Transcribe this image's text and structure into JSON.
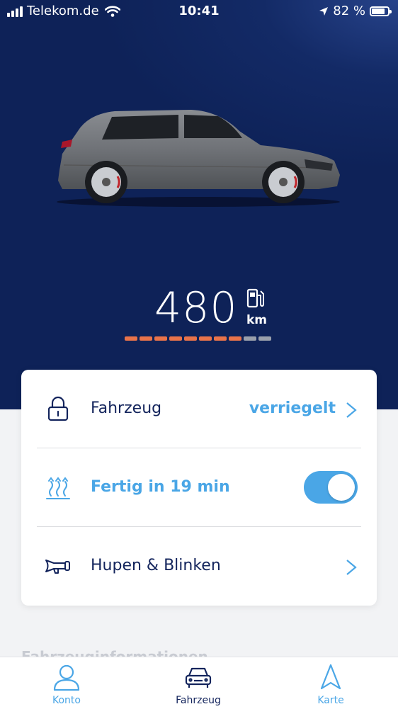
{
  "status_bar": {
    "carrier": "Telekom.de",
    "time": "10:41",
    "battery_percent": "82 %",
    "battery_level": 0.82
  },
  "vehicle": {
    "range_value": "480",
    "range_unit": "km",
    "range_segments_total": 10,
    "range_segments_filled": 8,
    "colors": {
      "filled": "#e8734a",
      "empty": "#9aa0ac"
    }
  },
  "controls": {
    "lock": {
      "label": "Fahrzeug",
      "value": "verriegelt",
      "icon": "lock-icon"
    },
    "climate": {
      "label": "Fertig in 19 min",
      "icon": "heat-waves-icon",
      "toggle_on": true
    },
    "horn": {
      "label": "Hupen & Blinken",
      "icon": "horn-icon"
    }
  },
  "section_heading": "Fahrzeuginformationen",
  "tabbar": {
    "account": "Konto",
    "vehicle": "Fahrzeug",
    "map": "Karte"
  },
  "colors": {
    "hero": "#0e2258",
    "accent": "#4aa6e6",
    "text_dark": "#13245c"
  }
}
